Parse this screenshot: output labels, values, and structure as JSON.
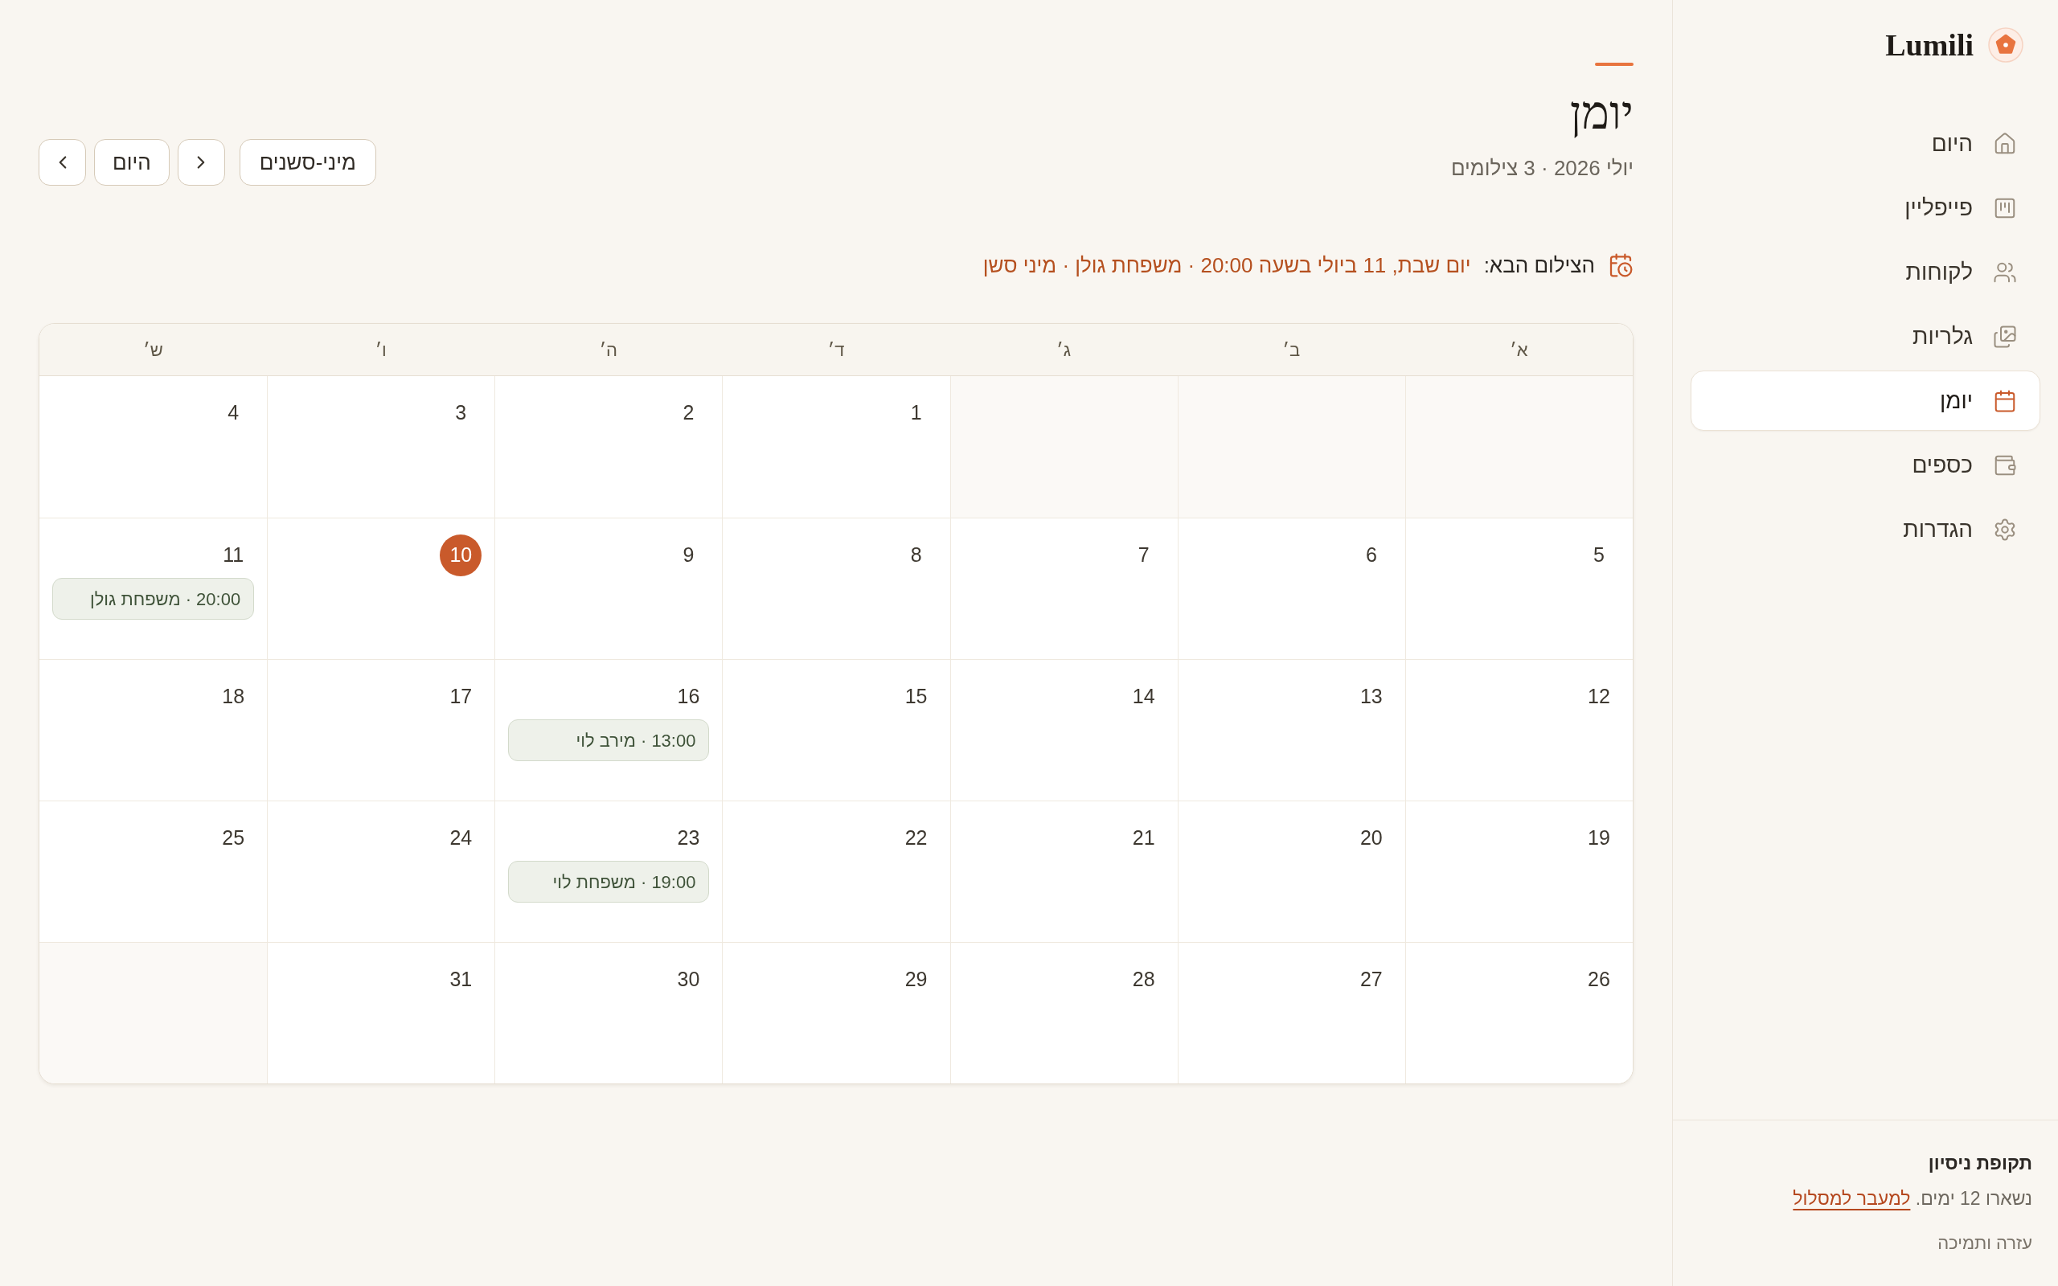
{
  "sidebar": {
    "logo": "Lumili",
    "nav": [
      {
        "label": "היום",
        "selected": false
      },
      {
        "label": "פייפליין",
        "selected": false
      },
      {
        "label": "לקוחות",
        "selected": false
      },
      {
        "label": "גלריות",
        "selected": false
      },
      {
        "label": "יומן",
        "selected": true
      },
      {
        "label": "כספים",
        "selected": false
      },
      {
        "label": "הגדרות",
        "selected": false
      }
    ],
    "trial": {
      "title": "תקופת ניסיון",
      "text": "נשארו 12 ימים.",
      "link": "למעבר למסלול"
    },
    "help": "עזרה ותמיכה"
  },
  "header": {
    "title": "יומן",
    "subtitle": "יולי 2026 · 3 צילומים",
    "controls": [
      {
        "kind": "filter",
        "label": "מיני-סשנים"
      },
      {
        "kind": "prev"
      },
      {
        "kind": "today",
        "label": "היום"
      },
      {
        "kind": "next"
      }
    ]
  },
  "next_shoot": {
    "label": "הצילום הבא:",
    "details": "יום שבת, 11 ביולי בשעה 20:00 · משפחת גולן · מיני סשן"
  },
  "calendar": {
    "weekdays": [
      "א׳",
      "ב׳",
      "ג׳",
      "ד׳",
      "ה׳",
      "ו׳",
      "ש׳"
    ],
    "weeks": [
      [
        {
          "kind": "blank"
        },
        {
          "kind": "blank"
        },
        {
          "kind": "blank"
        },
        {
          "kind": "day",
          "date": "1",
          "today": false
        },
        {
          "kind": "day",
          "date": "2",
          "today": false
        },
        {
          "kind": "day",
          "date": "3",
          "today": false
        },
        {
          "kind": "day",
          "date": "4",
          "today": false
        }
      ],
      [
        {
          "kind": "day",
          "date": "5",
          "today": false
        },
        {
          "kind": "day",
          "date": "6",
          "today": false
        },
        {
          "kind": "day",
          "date": "7",
          "today": false
        },
        {
          "kind": "day",
          "date": "8",
          "today": false
        },
        {
          "kind": "day",
          "date": "9",
          "today": false
        },
        {
          "kind": "day",
          "date": "10",
          "today": true
        },
        {
          "kind": "day",
          "date": "11",
          "today": false,
          "events": [
            "20:00 · משפחת גולן"
          ]
        }
      ],
      [
        {
          "kind": "day",
          "date": "12",
          "today": false
        },
        {
          "kind": "day",
          "date": "13",
          "today": false
        },
        {
          "kind": "day",
          "date": "14",
          "today": false
        },
        {
          "kind": "day",
          "date": "15",
          "today": false
        },
        {
          "kind": "day",
          "date": "16",
          "today": false,
          "events": [
            "13:00 · מירב לוי"
          ]
        },
        {
          "kind": "day",
          "date": "17",
          "today": false
        },
        {
          "kind": "day",
          "date": "18",
          "today": false
        }
      ],
      [
        {
          "kind": "day",
          "date": "19",
          "today": false
        },
        {
          "kind": "day",
          "date": "20",
          "today": false
        },
        {
          "kind": "day",
          "date": "21",
          "today": false
        },
        {
          "kind": "day",
          "date": "22",
          "today": false
        },
        {
          "kind": "day",
          "date": "23",
          "today": false,
          "events": [
            "19:00 · משפחת לוי"
          ]
        },
        {
          "kind": "day",
          "date": "24",
          "today": false
        },
        {
          "kind": "day",
          "date": "25",
          "today": false
        }
      ],
      [
        {
          "kind": "day",
          "date": "26",
          "today": false
        },
        {
          "kind": "day",
          "date": "27",
          "today": false
        },
        {
          "kind": "day",
          "date": "28",
          "today": false
        },
        {
          "kind": "day",
          "date": "29",
          "today": false
        },
        {
          "kind": "day",
          "date": "30",
          "today": false
        },
        {
          "kind": "day",
          "date": "31",
          "today": false
        },
        {
          "kind": "blank"
        }
      ]
    ]
  }
}
